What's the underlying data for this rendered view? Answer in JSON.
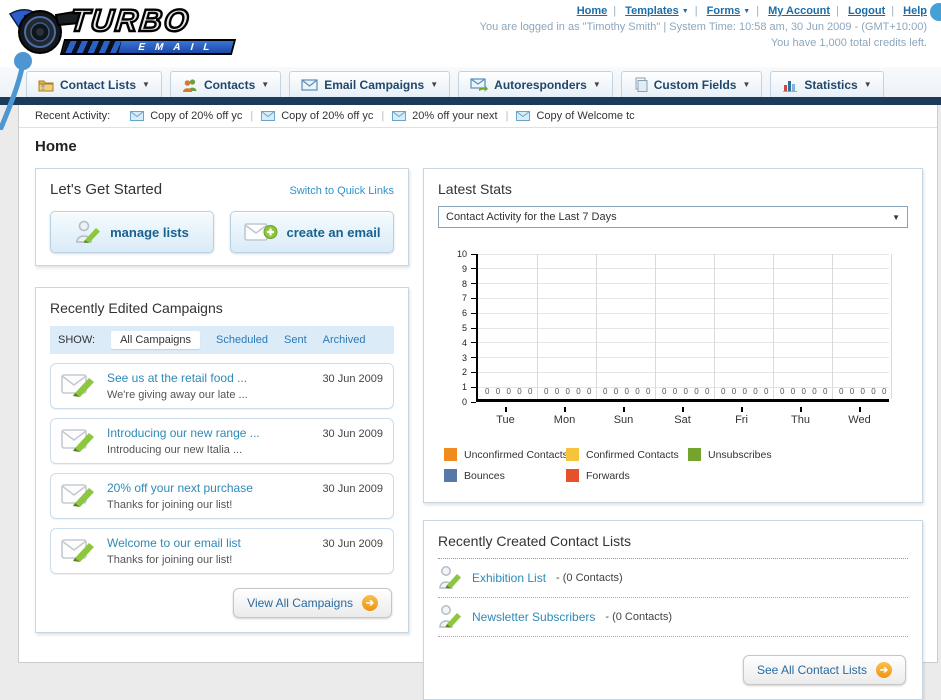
{
  "brand": {
    "title": "TURBO",
    "subtitle": "EMAIL"
  },
  "header": {
    "nav": [
      {
        "label": "Home"
      },
      {
        "label": "Templates"
      },
      {
        "label": "Forms"
      },
      {
        "label": "My Account"
      },
      {
        "label": "Logout"
      },
      {
        "label": "Help"
      }
    ],
    "login_line": "You are logged in as \"Timothy Smith\" | System Time: 10:58 am, 30 Jun 2009 - (GMT+10:00)",
    "credits_line": "You have 1,000 total credits left."
  },
  "nav_tabs": [
    {
      "label": "Contact Lists",
      "icon": "folder-contacts-icon"
    },
    {
      "label": "Contacts",
      "icon": "people-icon"
    },
    {
      "label": "Email Campaigns",
      "icon": "envelope-icon"
    },
    {
      "label": "Autoresponders",
      "icon": "envelope-arrow-icon"
    },
    {
      "label": "Custom Fields",
      "icon": "pages-icon"
    },
    {
      "label": "Statistics",
      "icon": "bar-chart-icon"
    }
  ],
  "recent_activity": {
    "label": "Recent Activity:",
    "items": [
      {
        "label": "Copy of 20% off yc"
      },
      {
        "label": "Copy of 20% off yc"
      },
      {
        "label": "20% off your next"
      },
      {
        "label": "Copy of Welcome tc"
      }
    ]
  },
  "page_title": "Home",
  "get_started": {
    "title": "Let's Get Started",
    "switch_link": "Switch to Quick Links",
    "buttons": [
      {
        "label": "manage lists"
      },
      {
        "label": "create an email"
      }
    ]
  },
  "campaigns": {
    "title": "Recently Edited Campaigns",
    "show_label": "SHOW:",
    "tabs": [
      {
        "label": "All Campaigns",
        "selected": true
      },
      {
        "label": "Scheduled",
        "selected": false
      },
      {
        "label": "Sent",
        "selected": false
      },
      {
        "label": "Archived",
        "selected": false
      }
    ],
    "items": [
      {
        "title": "See us at the retail food ...",
        "subtitle": "We're giving away our late ...",
        "date": "30 Jun 2009"
      },
      {
        "title": "Introducing our new range ...",
        "subtitle": "Introducing our new Italia ...",
        "date": "30 Jun 2009"
      },
      {
        "title": "20% off your next purchase",
        "subtitle": "Thanks for joining our list!",
        "date": "30 Jun 2009"
      },
      {
        "title": "Welcome to our email list",
        "subtitle": "Thanks for joining our list!",
        "date": "30 Jun 2009"
      }
    ],
    "view_all_label": "View All Campaigns"
  },
  "stats": {
    "title": "Latest Stats",
    "filter_value": "Contact Activity for the Last 7 Days"
  },
  "chart_data": {
    "type": "bar",
    "title": "Contact Activity for the Last 7 Days",
    "categories": [
      "Tue",
      "Mon",
      "Sun",
      "Sat",
      "Fri",
      "Thu",
      "Wed"
    ],
    "series": [
      {
        "name": "Unconfirmed Contacts",
        "color": "#f08c1e",
        "values": [
          0,
          0,
          0,
          0,
          0,
          0,
          0
        ]
      },
      {
        "name": "Confirmed Contacts",
        "color": "#f6c33d",
        "values": [
          0,
          0,
          0,
          0,
          0,
          0,
          0
        ]
      },
      {
        "name": "Unsubscribes",
        "color": "#74a32e",
        "values": [
          0,
          0,
          0,
          0,
          0,
          0,
          0
        ]
      },
      {
        "name": "Bounces",
        "color": "#5878a8",
        "values": [
          0,
          0,
          0,
          0,
          0,
          0,
          0
        ]
      },
      {
        "name": "Forwards",
        "color": "#e8502a",
        "values": [
          0,
          0,
          0,
          0,
          0,
          0,
          0
        ]
      }
    ],
    "ylim": [
      0,
      10
    ],
    "ytick_step": 1,
    "grid": true,
    "legend_position": "bottom"
  },
  "contact_lists": {
    "title": "Recently Created Contact Lists",
    "items": [
      {
        "name": "Exhibition List",
        "suffix": "- (0 Contacts)"
      },
      {
        "name": "Newsletter Subscribers",
        "suffix": "- (0 Contacts)"
      }
    ],
    "see_all_label": "See All Contact Lists"
  }
}
